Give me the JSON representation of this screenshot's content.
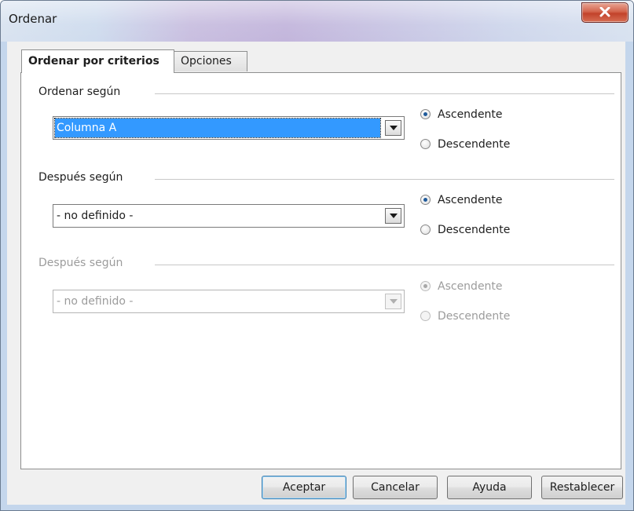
{
  "window": {
    "title": "Ordenar"
  },
  "tabs": [
    {
      "label": "Ordenar por criterios",
      "active": true
    },
    {
      "label": "Opciones",
      "active": false
    }
  ],
  "groups": [
    {
      "label": "Ordenar según",
      "combo_value": "Columna A",
      "enabled": true,
      "ascending_label": "Ascendente",
      "descending_label": "Descendente",
      "selected": "ascending"
    },
    {
      "label": "Después según",
      "combo_value": "- no definido -",
      "enabled": true,
      "ascending_label": "Ascendente",
      "descending_label": "Descendente",
      "selected": "ascending"
    },
    {
      "label": "Después según",
      "combo_value": "- no definido -",
      "enabled": false,
      "ascending_label": "Ascendente",
      "descending_label": "Descendente",
      "selected": "ascending"
    }
  ],
  "buttons": {
    "ok": "Aceptar",
    "cancel": "Cancelar",
    "help": "Ayuda",
    "reset": "Restablecer"
  },
  "icons": {
    "close": "close-x-icon",
    "dropdown": "triangle-down-icon"
  }
}
